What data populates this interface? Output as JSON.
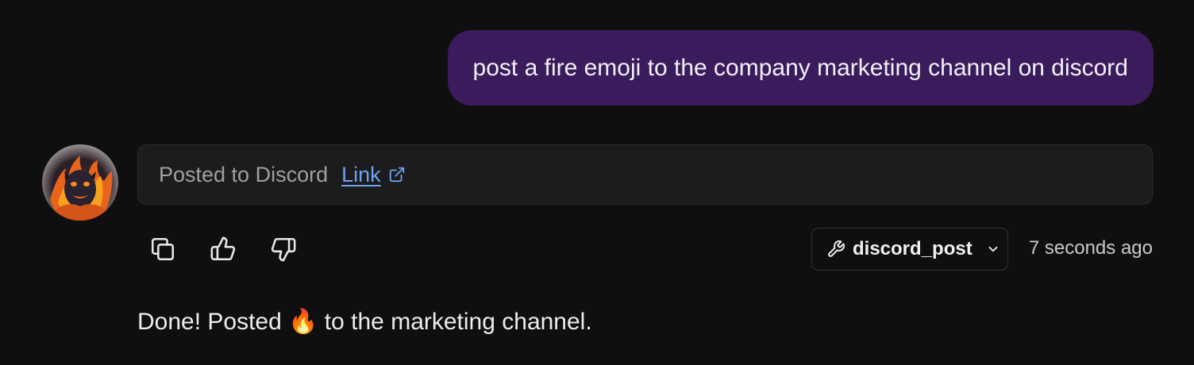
{
  "user_message": {
    "text": "post a fire emoji to the company marketing channel on discord"
  },
  "assistant": {
    "avatar_icon": "fire-demon-avatar",
    "tool_result": {
      "status_text": "Posted to Discord",
      "link_label": "Link",
      "link_icon": "external-link-icon"
    },
    "actions": [
      {
        "icon": "copy-icon"
      },
      {
        "icon": "thumbs-up-icon"
      },
      {
        "icon": "thumbs-down-icon"
      }
    ],
    "tool_chip": {
      "icon": "wrench-icon",
      "label": "discord_post",
      "chevron": "chevron-down-icon"
    },
    "timestamp": "7 seconds ago",
    "reply": "Done! Posted 🔥 to the marketing channel."
  },
  "colors": {
    "background": "#0f0f10",
    "user_bubble": "#3a1c5d",
    "tool_card": "#1c1c1d",
    "link": "#6ea2ec"
  }
}
